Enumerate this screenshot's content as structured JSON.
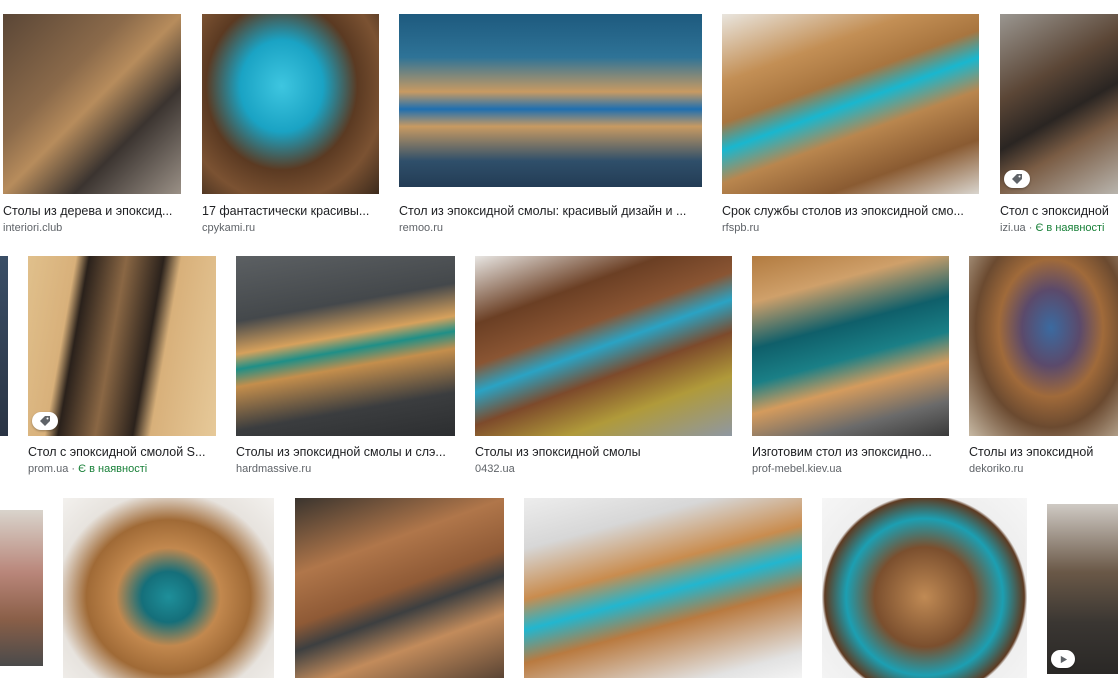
{
  "results": [
    {
      "title": "Столы из дерева и эпоксид...",
      "source": "interiori.club",
      "stock": ""
    },
    {
      "title": "17 фантастически красивы...",
      "source": "cpykami.ru",
      "stock": ""
    },
    {
      "title": "Стол из эпоксидной смолы: красивый дизайн и ...",
      "source": "remoo.ru",
      "stock": ""
    },
    {
      "title": "Срок службы столов из эпоксидной смо...",
      "source": "rfspb.ru",
      "stock": ""
    },
    {
      "title": "Стол с эпоксидной",
      "source": "izi.ua",
      "stock": "Є в наявності"
    },
    {
      "title": "Стол с эпоксидной смолой S...",
      "source": "prom.ua",
      "stock": "Є в наявності"
    },
    {
      "title": "Столы из эпоксидной смолы и слэ...",
      "source": "hardmassive.ru",
      "stock": ""
    },
    {
      "title": "Столы из эпоксидной смолы",
      "source": "0432.ua",
      "stock": ""
    },
    {
      "title": "Изготовим стол из эпоксидно...",
      "source": "prof-mebel.kiev.ua",
      "stock": ""
    },
    {
      "title": "Столы из эпоксидной",
      "source": "dekoriko.ru",
      "stock": ""
    }
  ],
  "colors": {
    "title_text": "#202124",
    "source_text": "#5f6368",
    "stock_text": "#188038"
  }
}
